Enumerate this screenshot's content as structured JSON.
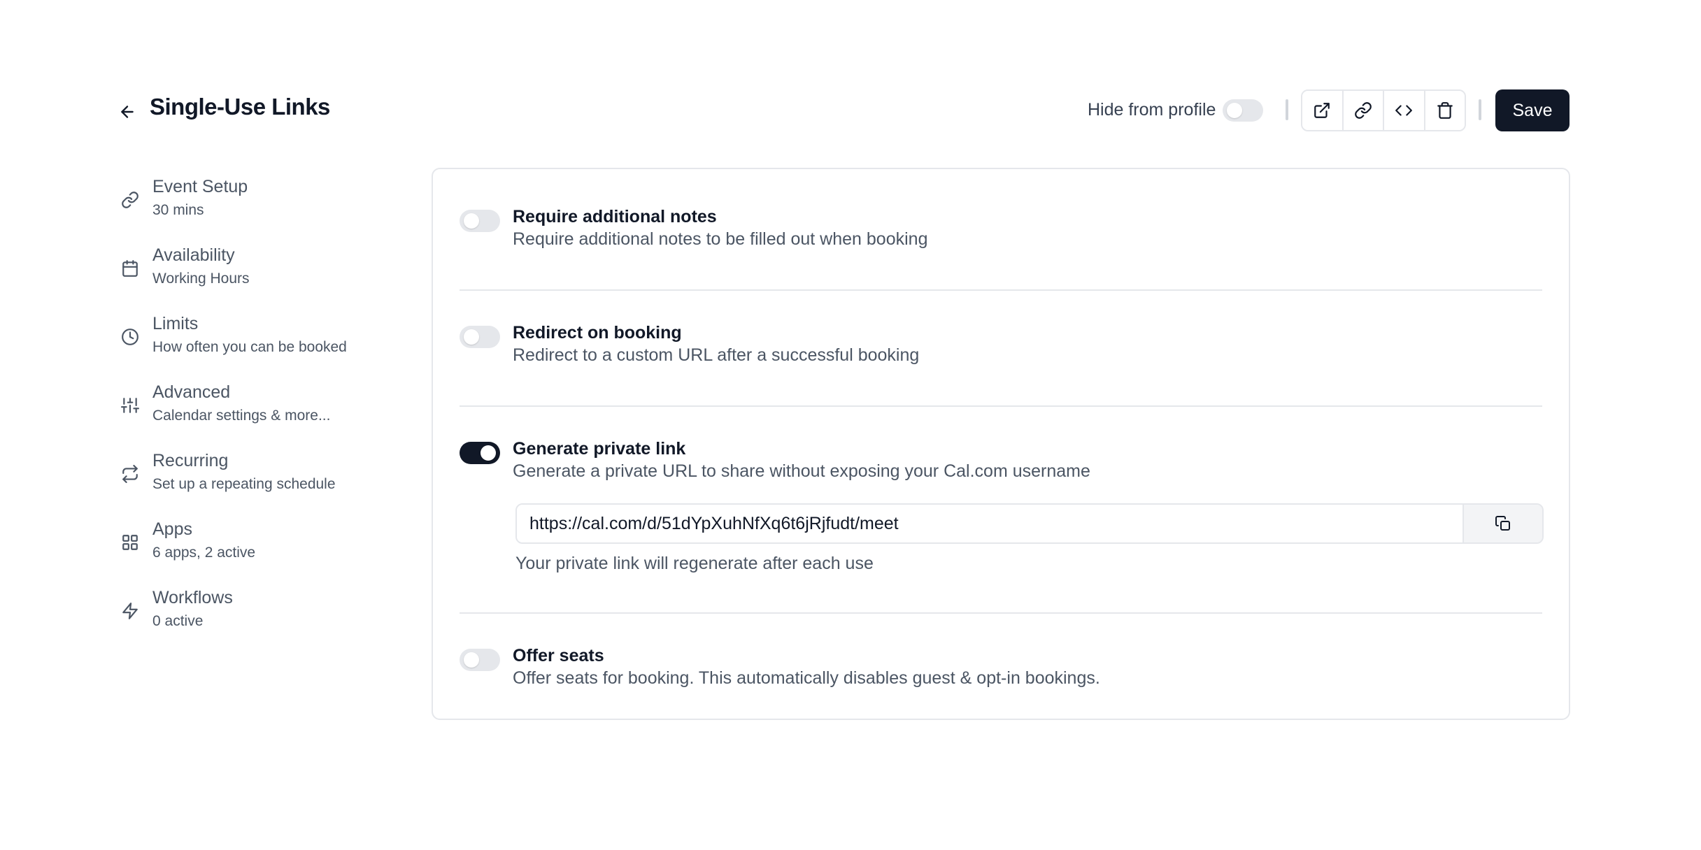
{
  "header": {
    "title": "Single-Use Links",
    "hide_from_profile_label": "Hide from profile",
    "hide_from_profile_enabled": false,
    "save_label": "Save"
  },
  "sidebar": {
    "items": [
      {
        "label": "Event Setup",
        "sublabel": "30 mins",
        "icon": "link-icon"
      },
      {
        "label": "Availability",
        "sublabel": "Working Hours",
        "icon": "calendar-icon"
      },
      {
        "label": "Limits",
        "sublabel": "How often you can be booked",
        "icon": "clock-icon"
      },
      {
        "label": "Advanced",
        "sublabel": "Calendar settings & more...",
        "icon": "sliders-icon"
      },
      {
        "label": "Recurring",
        "sublabel": "Set up a repeating schedule",
        "icon": "repeat-icon"
      },
      {
        "label": "Apps",
        "sublabel": "6 apps, 2 active",
        "icon": "grid-icon"
      },
      {
        "label": "Workflows",
        "sublabel": "0 active",
        "icon": "zap-icon"
      }
    ]
  },
  "settings": {
    "require_notes": {
      "title": "Require additional notes",
      "description": "Require additional notes to be filled out when booking",
      "enabled": false
    },
    "redirect": {
      "title": "Redirect on booking",
      "description": "Redirect to a custom URL after a successful booking",
      "enabled": false
    },
    "private_link": {
      "title": "Generate private link",
      "description": "Generate a private URL to share without exposing your Cal.com username",
      "enabled": true,
      "url": "https://cal.com/d/51dYpXuhNfXq6t6jRjfudt/meet",
      "hint": "Your private link will regenerate after each use"
    },
    "offer_seats": {
      "title": "Offer seats",
      "description": "Offer seats for booking. This automatically disables guest & opt-in bookings.",
      "enabled": false
    }
  }
}
